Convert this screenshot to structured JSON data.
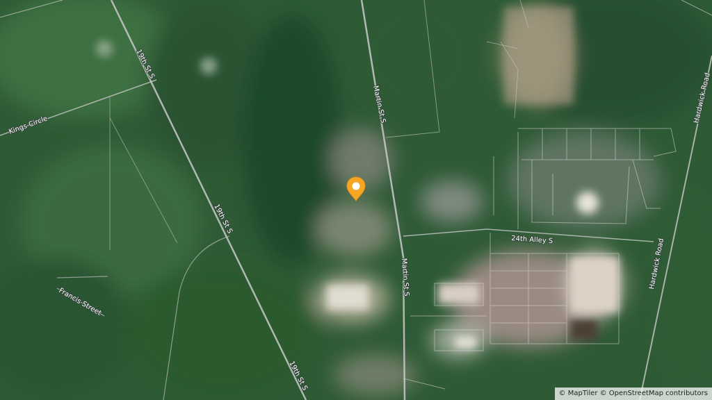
{
  "map": {
    "streets": {
      "street_19th_upper": "19th St S",
      "street_19th_middle": "19th St S",
      "street_19th_lower": "19th St S",
      "kings_circle": "Kings Circle",
      "francis_street": "Francis Street",
      "martin_upper": "Martin St S",
      "martin_lower": "Martin St S",
      "alley_24th": "24th Alley S",
      "hardwick_upper": "Hardwick Road",
      "hardwick_lower": "Hardwick Road"
    },
    "marker": {
      "color": "#f5a623",
      "icon": "location-pin-icon"
    },
    "attribution": "© MapTiler © OpenStreetMap contributors"
  }
}
